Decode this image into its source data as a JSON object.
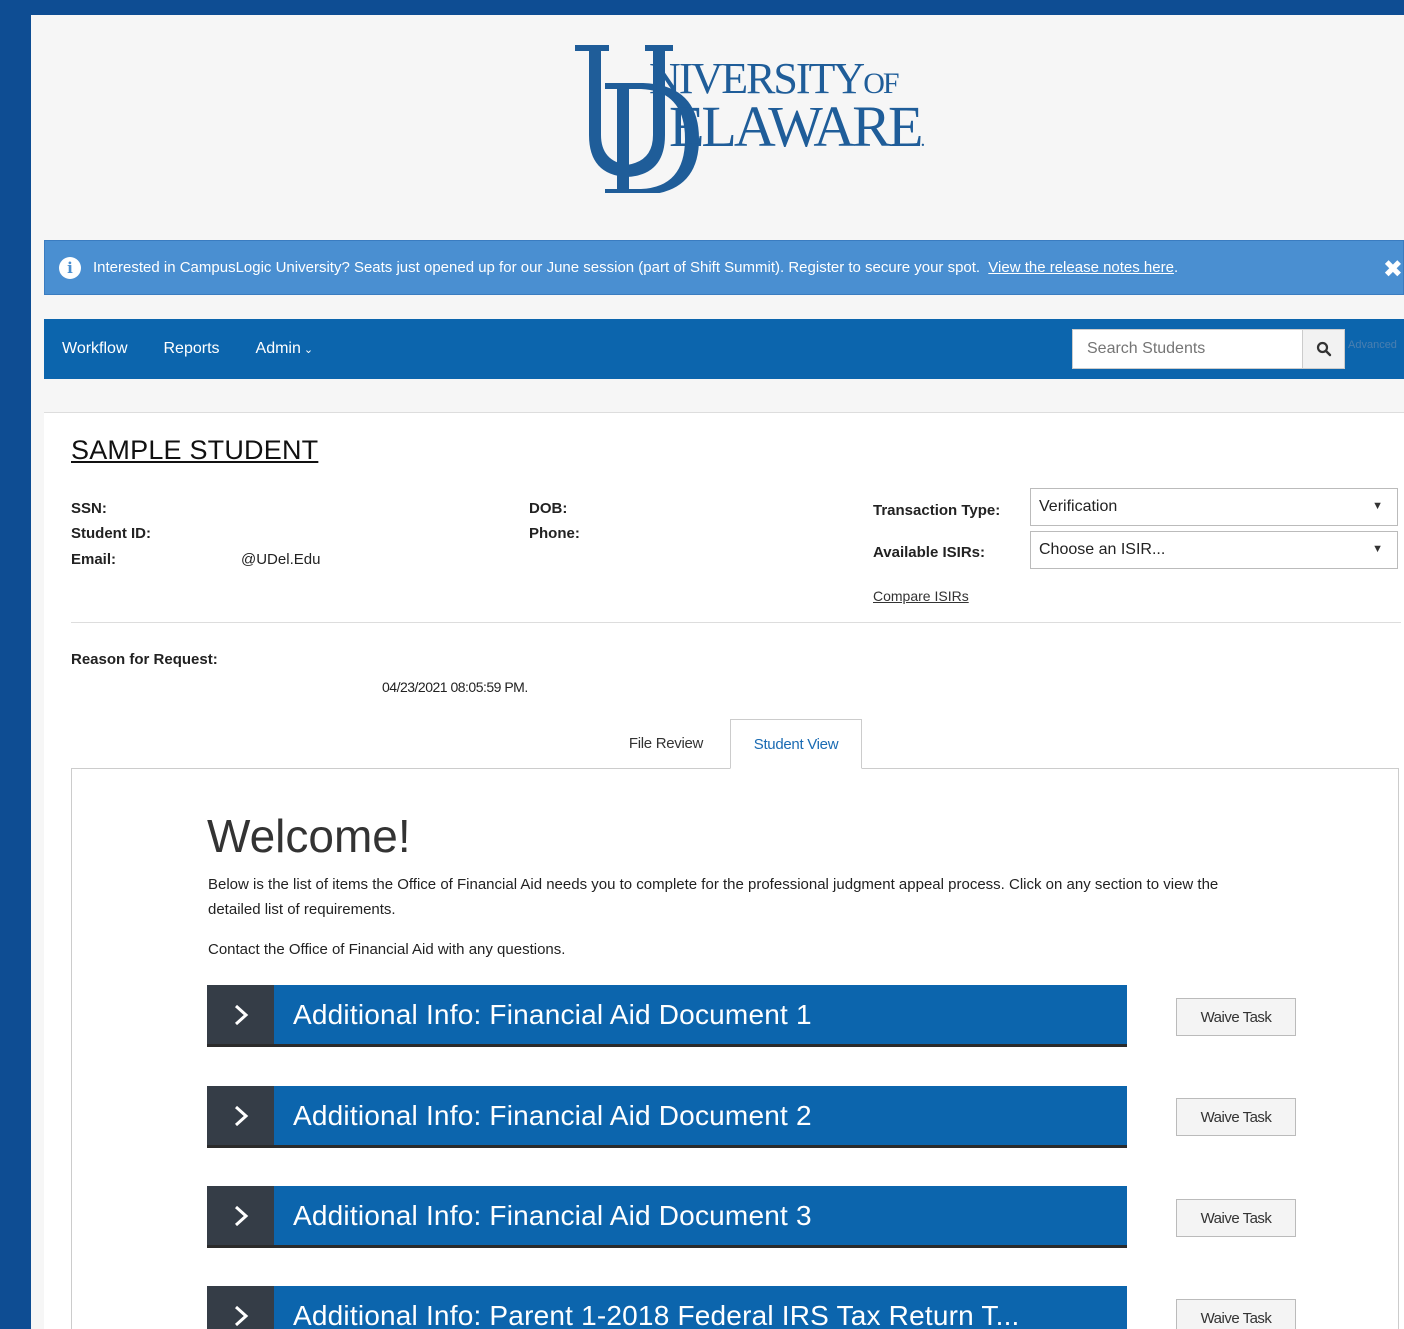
{
  "logo": {
    "u": "U",
    "niversity": "NIVERSITY",
    "of": "OF",
    "d": "D",
    "elaware": "ELAWARE",
    "dot": "."
  },
  "banner": {
    "message": "Interested in CampusLogic University? Seats just opened up for our June session (part of Shift Summit). Register to secure your spot.",
    "link": "View the release notes here",
    "link_suffix": "."
  },
  "nav": {
    "workflow": "Workflow",
    "reports": "Reports",
    "admin": "Admin",
    "search_placeholder": "Search Students",
    "advanced": "Advanced"
  },
  "student": {
    "name": "SAMPLE STUDENT",
    "ssn_label": "SSN:",
    "student_id_label": "Student ID:",
    "email_label": "Email:",
    "email_value": "@UDel.Edu",
    "dob_label": "DOB:",
    "phone_label": "Phone:",
    "transaction_type_label": "Transaction Type:",
    "transaction_type_value": "Verification",
    "isirs_label": "Available ISIRs:",
    "isirs_value": "Choose an ISIR...",
    "compare_link": "Compare ISIRs",
    "reason_label": "Reason for Request:",
    "timestamp": "04/23/2021 08:05:59 PM."
  },
  "tabs": {
    "file_review": "File Review",
    "student_view": "Student View"
  },
  "content": {
    "welcome": "Welcome!",
    "intro": "Below is the list of items the Office of Financial Aid needs you to complete for the professional judgment appeal process. Click on any section to view the detailed list of requirements.",
    "contact": "Contact the Office of Financial Aid with any questions.",
    "tasks": [
      {
        "title": "Additional Info: Financial Aid Document 1",
        "action": "Waive Task"
      },
      {
        "title": "Additional Info: Financial Aid Document 2",
        "action": "Waive Task"
      },
      {
        "title": "Additional Info: Financial Aid Document 3",
        "action": "Waive Task"
      },
      {
        "title": "Additional Info: Parent 1-2018 Federal IRS Tax Return T...",
        "action": "Waive Task"
      }
    ]
  },
  "colors": {
    "page_background": "#0e4d93",
    "nav_blue": "#0c65ad",
    "banner_blue": "#4a8fd1",
    "task_chevron_bg": "#353d47",
    "logo_blue": "#1f5d99"
  },
  "icons": {
    "banner_info": "info-circle-icon",
    "banner_close": "close-icon",
    "search": "magnifier-icon",
    "admin_dropdown": "chevron-down-icon",
    "task_expand": "chevron-right-icon",
    "select_caret": "caret-down-icon"
  }
}
